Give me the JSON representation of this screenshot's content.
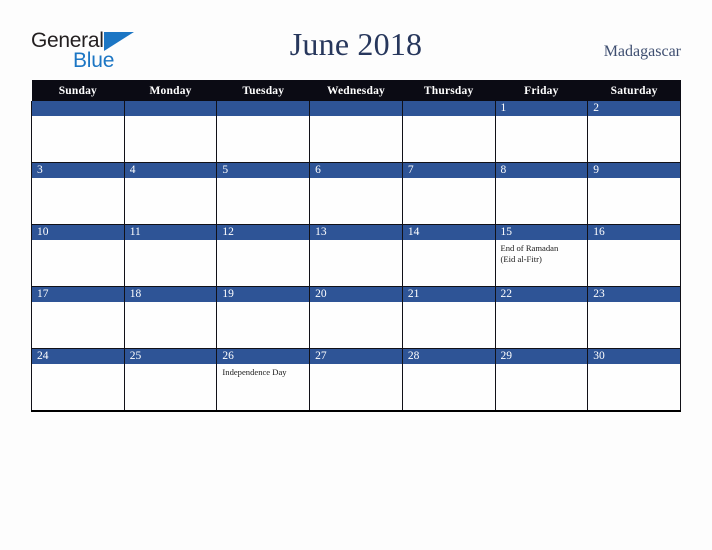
{
  "brand": {
    "name_part1": "General",
    "name_part2": "Blue",
    "triangle_color": "#1c76c4",
    "text_color": "#231f20"
  },
  "header": {
    "title": "June 2018",
    "country": "Madagascar",
    "title_color": "#27375c"
  },
  "calendar": {
    "accent_color": "#2e5496",
    "header_bg": "#0b0b14",
    "weekdays": [
      "Sunday",
      "Monday",
      "Tuesday",
      "Wednesday",
      "Thursday",
      "Friday",
      "Saturday"
    ],
    "weeks": [
      [
        {
          "date": "",
          "events": []
        },
        {
          "date": "",
          "events": []
        },
        {
          "date": "",
          "events": []
        },
        {
          "date": "",
          "events": []
        },
        {
          "date": "",
          "events": []
        },
        {
          "date": "1",
          "events": []
        },
        {
          "date": "2",
          "events": []
        }
      ],
      [
        {
          "date": "3",
          "events": []
        },
        {
          "date": "4",
          "events": []
        },
        {
          "date": "5",
          "events": []
        },
        {
          "date": "6",
          "events": []
        },
        {
          "date": "7",
          "events": []
        },
        {
          "date": "8",
          "events": []
        },
        {
          "date": "9",
          "events": []
        }
      ],
      [
        {
          "date": "10",
          "events": []
        },
        {
          "date": "11",
          "events": []
        },
        {
          "date": "12",
          "events": []
        },
        {
          "date": "13",
          "events": []
        },
        {
          "date": "14",
          "events": []
        },
        {
          "date": "15",
          "events": [
            "End of Ramadan",
            "(Eid al-Fitr)"
          ]
        },
        {
          "date": "16",
          "events": []
        }
      ],
      [
        {
          "date": "17",
          "events": []
        },
        {
          "date": "18",
          "events": []
        },
        {
          "date": "19",
          "events": []
        },
        {
          "date": "20",
          "events": []
        },
        {
          "date": "21",
          "events": []
        },
        {
          "date": "22",
          "events": []
        },
        {
          "date": "23",
          "events": []
        }
      ],
      [
        {
          "date": "24",
          "events": []
        },
        {
          "date": "25",
          "events": []
        },
        {
          "date": "26",
          "events": [
            "Independence Day"
          ]
        },
        {
          "date": "27",
          "events": []
        },
        {
          "date": "28",
          "events": []
        },
        {
          "date": "29",
          "events": []
        },
        {
          "date": "30",
          "events": []
        }
      ]
    ]
  }
}
